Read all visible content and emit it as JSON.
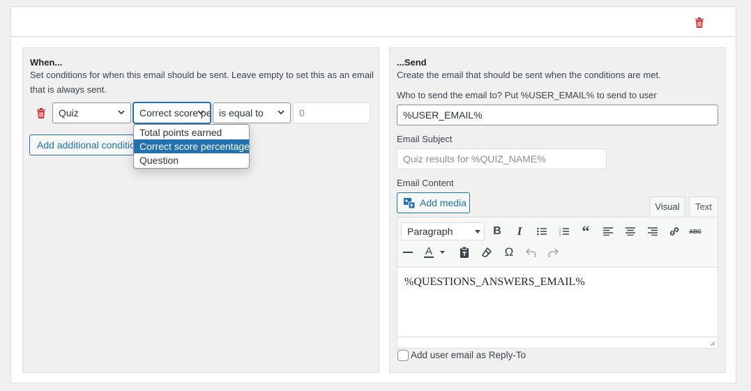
{
  "when": {
    "title": "When...",
    "desc_line1": "Set conditions for when this email should be sent. Leave empty to set this as an email",
    "desc_line2": "that is always sent.",
    "condition": {
      "field_value": "Quiz",
      "subfield_value": "Correct score percentage",
      "operator_value": "is equal to",
      "value": "0"
    },
    "dropdown_options": [
      "Total points earned",
      "Correct score percentage",
      "Question"
    ],
    "add_condition_label": "Add additional condition"
  },
  "send": {
    "title": "...Send",
    "desc": "Create the email that should be sent when the conditions are met.",
    "to_label": "Who to send the email to? Put %USER_EMAIL% to send to user",
    "to_value": "%USER_EMAIL%",
    "subject_label": "Email Subject",
    "subject_placeholder": "Quiz results for %QUIZ_NAME%",
    "content_label": "Email Content",
    "add_media_label": "Add media",
    "tab_visual": "Visual",
    "tab_text": "Text",
    "format_value": "Paragraph",
    "editor_content": "%QUESTIONS_ANSWERS_EMAIL%",
    "reply_to_label": "Add user email as Reply-To",
    "reply_to_checked": false
  },
  "colors": {
    "accent": "#2271b1",
    "danger": "#d63638"
  },
  "icons": {
    "trash": "trash-icon",
    "add_media": "add-media-icon",
    "bold": "bold-icon",
    "italic": "italic-icon",
    "bullet_list": "bullet-list-icon",
    "numbered_list": "numbered-list-icon",
    "blockquote": "blockquote-icon",
    "align_left": "align-left-icon",
    "align_center": "align-center-icon",
    "align_right": "align-right-icon",
    "link": "link-icon",
    "strikethrough": "strikethrough-icon",
    "horizontal_line": "horizontal-line-icon",
    "text_color": "text-color-icon",
    "paste_text": "paste-text-icon",
    "clear_formatting": "clear-formatting-icon",
    "special_char": "special-character-icon",
    "undo": "undo-icon",
    "redo": "redo-icon"
  }
}
